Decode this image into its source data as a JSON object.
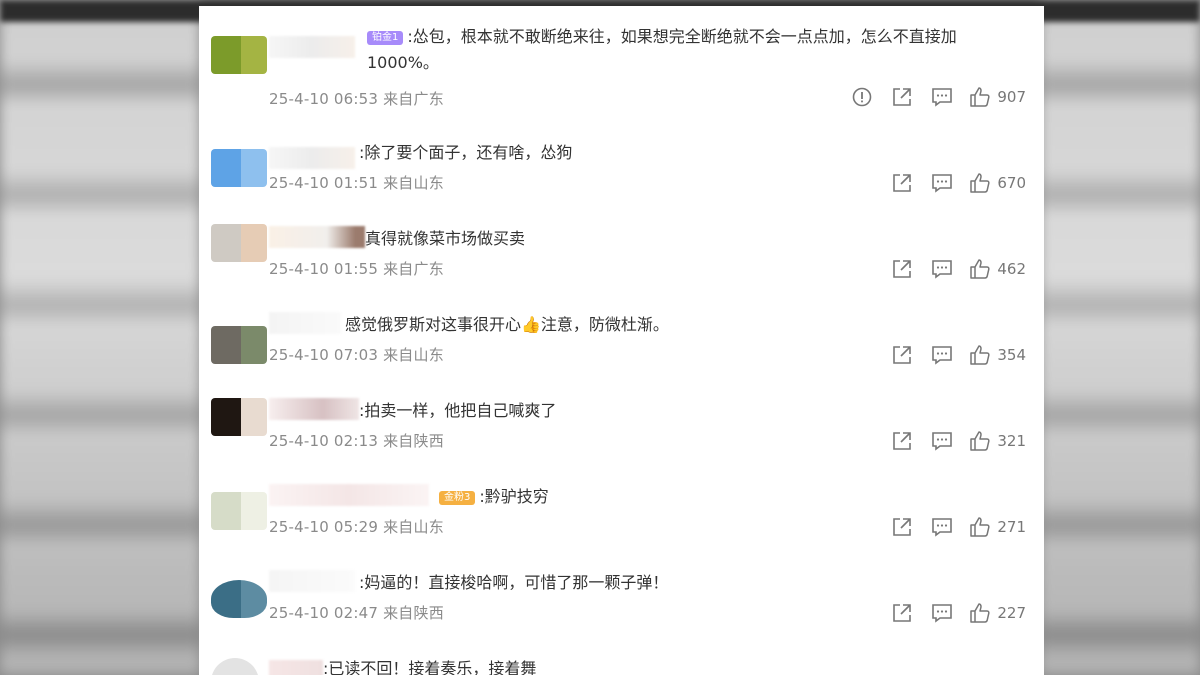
{
  "comments": [
    {
      "badge": "铂金1",
      "badge_color": "#a78bfa",
      "text": ":怂包，根本就不敢断绝来往，如果想完全断绝就不会一点点加，怎么不直接加1000%。",
      "time": "25-4-10 06:53",
      "location": "来自广东",
      "likes": "907",
      "has_report": true
    },
    {
      "text": ":除了要个面子，还有啥，怂狗",
      "time": "25-4-10 01:51",
      "location": "来自山东",
      "likes": "670",
      "has_report": false
    },
    {
      "text": "真得就像菜市场做买卖",
      "time": "25-4-10 01:55",
      "location": "来自广东",
      "likes": "462",
      "has_report": false
    },
    {
      "text": "感觉俄罗斯对这事很开心👍注意，防微杜渐。",
      "time": "25-4-10 07:03",
      "location": "来自山东",
      "likes": "354",
      "has_report": false
    },
    {
      "text": ":拍卖一样，他把自己喊爽了",
      "time": "25-4-10 02:13",
      "location": "来自陕西",
      "likes": "321",
      "has_report": false
    },
    {
      "badge": "金粉3",
      "badge_color": "#f5b041",
      "text": ":黔驴技穷",
      "time": "25-4-10 05:29",
      "location": "来自山东",
      "likes": "271",
      "has_report": false
    },
    {
      "text": ":妈逼的！直接梭哈啊，可惜了那一颗子弹！",
      "time": "25-4-10 02:47",
      "location": "来自陕西",
      "likes": "227",
      "has_report": false
    },
    {
      "text": ":已读不回！接着奏乐，接着舞",
      "time": "",
      "location": "",
      "likes": "",
      "has_report": false
    }
  ],
  "icons": {
    "report": "report-icon",
    "share": "share-icon",
    "reply": "comment-icon",
    "like": "thumbs-up-icon"
  }
}
